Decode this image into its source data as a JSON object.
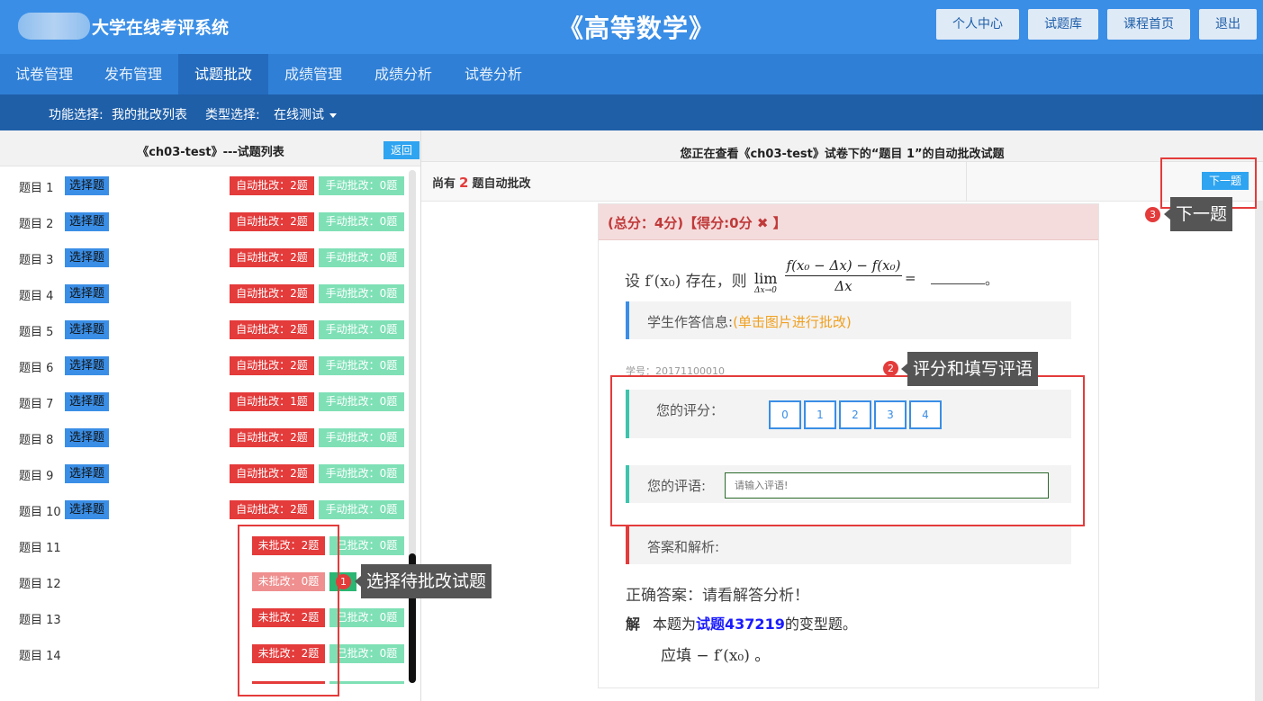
{
  "header": {
    "system_title": "大学在线考评系统",
    "course_title": "《高等数学》",
    "buttons": [
      "个人中心",
      "试题库",
      "课程首页",
      "退出"
    ]
  },
  "nav": {
    "tabs": [
      "试卷管理",
      "发布管理",
      "试题批改",
      "成绩管理",
      "成绩分析",
      "试卷分析"
    ],
    "active": "试题批改"
  },
  "subbar": {
    "func_label": "功能选择:",
    "func_value": "我的批改列表",
    "type_label": "类型选择:",
    "type_value": "在线测试"
  },
  "left": {
    "title": "《ch03-test》---试题列表",
    "back": "返回",
    "questions": [
      {
        "label": "题目 1",
        "type": "选择题",
        "auto": "自动批改：2题",
        "manual": "手动批改：0题"
      },
      {
        "label": "题目 2",
        "type": "选择题",
        "auto": "自动批改：2题",
        "manual": "手动批改：0题"
      },
      {
        "label": "题目 3",
        "type": "选择题",
        "auto": "自动批改：2题",
        "manual": "手动批改：0题"
      },
      {
        "label": "题目 4",
        "type": "选择题",
        "auto": "自动批改：2题",
        "manual": "手动批改：0题"
      },
      {
        "label": "题目 5",
        "type": "选择题",
        "auto": "自动批改：2题",
        "manual": "手动批改：0题"
      },
      {
        "label": "题目 6",
        "type": "选择题",
        "auto": "自动批改：2题",
        "manual": "手动批改：0题"
      },
      {
        "label": "题目 7",
        "type": "选择题",
        "auto": "自动批改：1题",
        "manual": "手动批改：0题"
      },
      {
        "label": "题目 8",
        "type": "选择题",
        "auto": "自动批改：2题",
        "manual": "手动批改：0题"
      },
      {
        "label": "题目 9",
        "type": "选择题",
        "auto": "自动批改：2题",
        "manual": "手动批改：0题"
      },
      {
        "label": "题目 10",
        "type": "选择题",
        "auto": "自动批改：2题",
        "manual": "手动批改：0题"
      },
      {
        "label": "题目 11",
        "type": "",
        "auto": "未批改：2题",
        "manual": "已批改：0题"
      },
      {
        "label": "题目 12",
        "type": "",
        "auto": "未批改：0题",
        "manual": ""
      },
      {
        "label": "题目 13",
        "type": "",
        "auto": "未批改：2题",
        "manual": "已批改：0题"
      },
      {
        "label": "题目 14",
        "type": "",
        "auto": "未批改：2题",
        "manual": "已批改：0题"
      }
    ]
  },
  "right": {
    "title": "您正在查看《ch03-test》试卷下的“题目 1”的自动批改试题",
    "remain_prefix": "尚有",
    "remain_count": "2",
    "remain_suffix": "题自动批改",
    "next": "下一题",
    "score_head": "(总分：4分)【得分:0分",
    "score_mark": "✖",
    "score_tail": "】",
    "question_prefix": "设 f′(x₀) 存在，则",
    "lim": "lim",
    "lim_sub": "Δx→0",
    "frac_num": "f(x₀ − Δx) − f(x₀)",
    "frac_den": "Δx",
    "eq": "=",
    "period": "。",
    "student_info_label": "学生作答信息:",
    "student_info_hint": "(单击图片进行批改)",
    "student_id": "学号：20171100010",
    "your_score": "您的评分：",
    "scores": [
      "0",
      "1",
      "2",
      "3",
      "4"
    ],
    "your_comment": "您的评语:",
    "comment_placeholder": "请输入评语!",
    "answer_label": "答案和解析:",
    "correct_answer": "正确答案：请看解答分析！",
    "sol_j": "解",
    "sol_prefix": "本题为",
    "sol_link": "试题437219",
    "sol_suffix": "的变型题。",
    "fill": "应填 − f′(x₀) 。"
  },
  "tips": {
    "t1": "选择待批改试题",
    "t2": "评分和填写评语",
    "t3": "下一题",
    "n1": "1",
    "n2": "2",
    "n3": "3"
  }
}
